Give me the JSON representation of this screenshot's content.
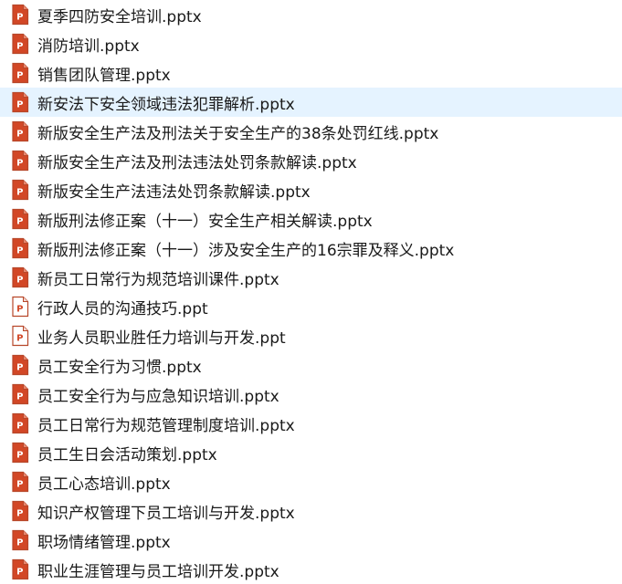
{
  "theme": {
    "icon_red": "#d24726",
    "icon_red_dark": "#b7472a",
    "icon_light_fill": "#ffffff",
    "selection_bg": "#e5f3ff",
    "text_color": "#1a1a1a"
  },
  "files": [
    {
      "name": "夏季四防安全培训.pptx",
      "icon": "pptx-file-icon",
      "selected": false
    },
    {
      "name": "消防培训.pptx",
      "icon": "pptx-file-icon",
      "selected": false
    },
    {
      "name": "销售团队管理.pptx",
      "icon": "pptx-file-icon",
      "selected": false
    },
    {
      "name": "新安法下安全领域违法犯罪解析.pptx",
      "icon": "pptx-file-icon",
      "selected": true
    },
    {
      "name": "新版安全生产法及刑法关于安全生产的38条处罚红线.pptx",
      "icon": "pptx-file-icon",
      "selected": false
    },
    {
      "name": "新版安全生产法及刑法违法处罚条款解读.pptx",
      "icon": "pptx-file-icon",
      "selected": false
    },
    {
      "name": "新版安全生产法违法处罚条款解读.pptx",
      "icon": "pptx-file-icon",
      "selected": false
    },
    {
      "name": "新版刑法修正案（十一）安全生产相关解读.pptx",
      "icon": "pptx-file-icon",
      "selected": false
    },
    {
      "name": "新版刑法修正案（十一）涉及安全生产的16宗罪及释义.pptx",
      "icon": "pptx-file-icon",
      "selected": false
    },
    {
      "name": "新员工日常行为规范培训课件.pptx",
      "icon": "pptx-file-icon",
      "selected": false
    },
    {
      "name": "行政人员的沟通技巧.ppt",
      "icon": "ppt-file-icon",
      "selected": false
    },
    {
      "name": "业务人员职业胜任力培训与开发.ppt",
      "icon": "ppt-file-icon",
      "selected": false
    },
    {
      "name": "员工安全行为习惯.pptx",
      "icon": "pptx-file-icon",
      "selected": false
    },
    {
      "name": "员工安全行为与应急知识培训.pptx",
      "icon": "pptx-file-icon",
      "selected": false
    },
    {
      "name": "员工日常行为规范管理制度培训.pptx",
      "icon": "pptx-file-icon",
      "selected": false
    },
    {
      "name": "员工生日会活动策划.pptx",
      "icon": "pptx-file-icon",
      "selected": false
    },
    {
      "name": "员工心态培训.pptx",
      "icon": "pptx-file-icon",
      "selected": false
    },
    {
      "name": "知识产权管理下员工培训与开发.pptx",
      "icon": "pptx-file-icon",
      "selected": false
    },
    {
      "name": "职场情绪管理.pptx",
      "icon": "pptx-file-icon",
      "selected": false
    },
    {
      "name": "职业生涯管理与员工培训开发.pptx",
      "icon": "pptx-file-icon",
      "selected": false
    }
  ]
}
